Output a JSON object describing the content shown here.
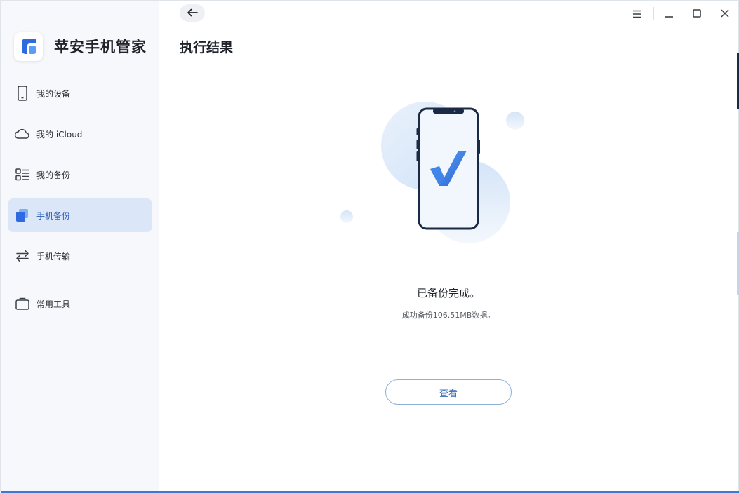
{
  "app": {
    "name": "苹安手机管家",
    "accent_color": "#3c78d8"
  },
  "sidebar": {
    "items": [
      {
        "label": "我的设备",
        "icon": "phone-icon",
        "active": false
      },
      {
        "label": "我的 iCloud",
        "icon": "cloud-icon",
        "active": false
      },
      {
        "label": "我的备份",
        "icon": "list-icon",
        "active": false
      },
      {
        "label": "手机备份",
        "icon": "backup-icon",
        "active": true
      },
      {
        "label": "手机传输",
        "icon": "transfer-arrows-icon",
        "active": false
      },
      {
        "label": "常用工具",
        "icon": "toolbox-icon",
        "active": false
      }
    ]
  },
  "header": {
    "back_icon": "arrow-left-icon",
    "controls": [
      "menu-icon",
      "minimize-icon",
      "maximize-icon",
      "close-icon"
    ]
  },
  "main": {
    "title": "执行结果",
    "result_title": "已备份完成。",
    "result_subtitle": "成功备份106.51MB数据。",
    "view_button": "查看"
  }
}
